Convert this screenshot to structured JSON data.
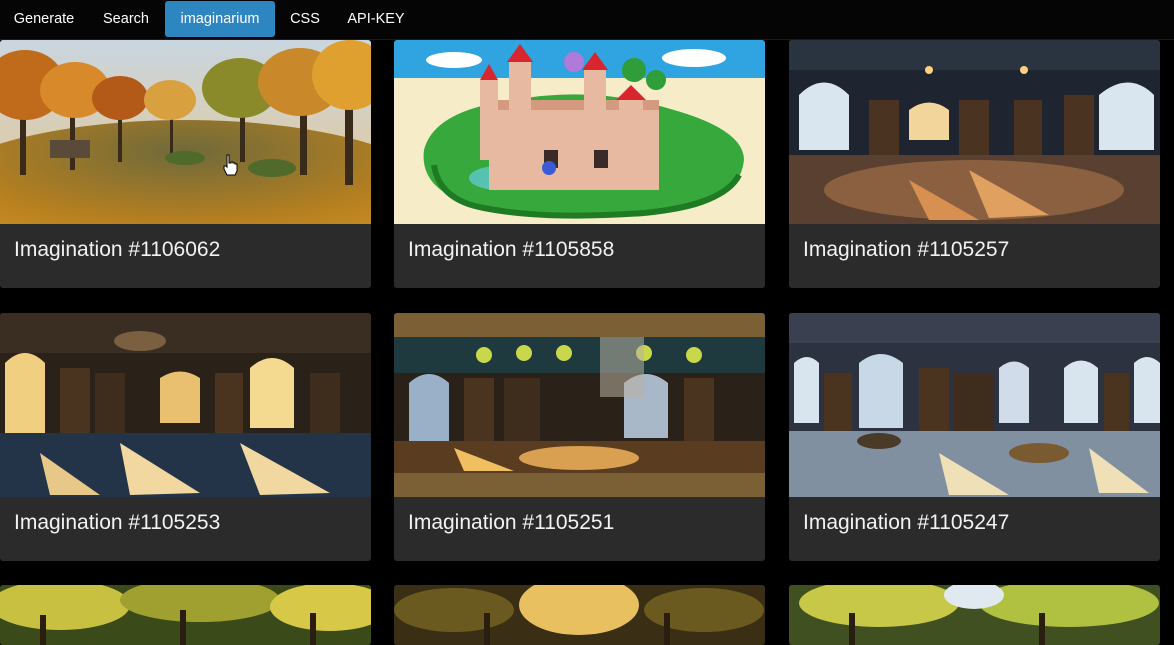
{
  "nav": {
    "tabs": [
      {
        "label": "Generate",
        "active": false
      },
      {
        "label": "Search",
        "active": false
      },
      {
        "label": "imaginarium",
        "active": true
      },
      {
        "label": "CSS",
        "active": false
      },
      {
        "label": "API-KEY",
        "active": false
      }
    ]
  },
  "colors": {
    "background": "#000000",
    "card": "#2b2b2b",
    "active_tab": "#2e86c1",
    "text": "#f2f2f2"
  },
  "gallery": {
    "cards": [
      {
        "title": "Imagination #1106062",
        "image": "autumn-park-panorama"
      },
      {
        "title": "Imagination #1105858",
        "image": "pixel-castle-island"
      },
      {
        "title": "Imagination #1105257",
        "image": "library-panorama-dusk"
      },
      {
        "title": "Imagination #1105253",
        "image": "library-panorama-round"
      },
      {
        "title": "Imagination #1105251",
        "image": "library-panorama-stained-glass"
      },
      {
        "title": "Imagination #1105247",
        "image": "library-panorama-blue"
      },
      {
        "title": "",
        "image": "forest-canopy-panorama"
      },
      {
        "title": "",
        "image": "forest-canopy-panorama-golden"
      },
      {
        "title": "",
        "image": "forest-canopy-panorama-bright"
      }
    ]
  }
}
